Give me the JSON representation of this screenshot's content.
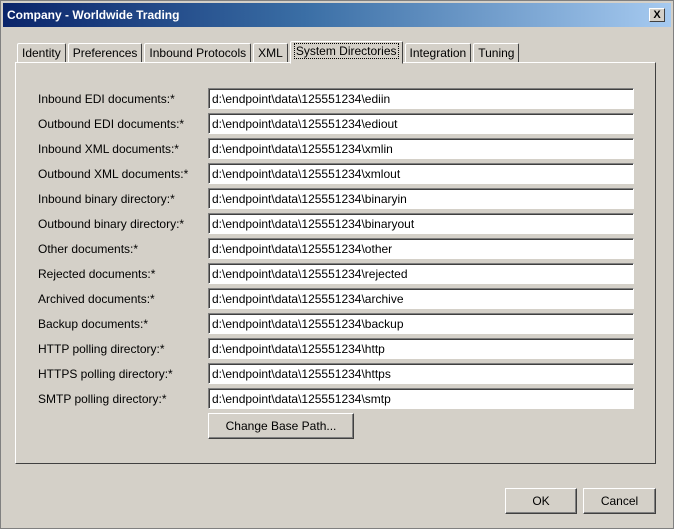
{
  "window": {
    "title": "Company - Worldwide Trading",
    "close_label": "X"
  },
  "tabs": [
    {
      "label": "Identity"
    },
    {
      "label": "Preferences"
    },
    {
      "label": "Inbound Protocols"
    },
    {
      "label": "XML"
    },
    {
      "label": "System Directories",
      "active": true
    },
    {
      "label": "Integration"
    },
    {
      "label": "Tuning"
    }
  ],
  "fields": [
    {
      "label": "Inbound EDI documents:*",
      "value": "d:\\endpoint\\data\\125551234\\ediin"
    },
    {
      "label": "Outbound EDI documents:*",
      "value": "d:\\endpoint\\data\\125551234\\ediout"
    },
    {
      "label": "Inbound XML documents:*",
      "value": "d:\\endpoint\\data\\125551234\\xmlin"
    },
    {
      "label": "Outbound XML documents:*",
      "value": "d:\\endpoint\\data\\125551234\\xmlout"
    },
    {
      "label": "Inbound binary directory:*",
      "value": "d:\\endpoint\\data\\125551234\\binaryin"
    },
    {
      "label": "Outbound binary directory:*",
      "value": "d:\\endpoint\\data\\125551234\\binaryout"
    },
    {
      "label": "Other documents:*",
      "value": "d:\\endpoint\\data\\125551234\\other"
    },
    {
      "label": "Rejected documents:*",
      "value": "d:\\endpoint\\data\\125551234\\rejected"
    },
    {
      "label": "Archived documents:*",
      "value": "d:\\endpoint\\data\\125551234\\archive"
    },
    {
      "label": "Backup documents:*",
      "value": "d:\\endpoint\\data\\125551234\\backup"
    },
    {
      "label": "HTTP polling directory:*",
      "value": "d:\\endpoint\\data\\125551234\\http"
    },
    {
      "label": "HTTPS polling directory:*",
      "value": "d:\\endpoint\\data\\125551234\\https"
    },
    {
      "label": "SMTP polling directory:*",
      "value": "d:\\endpoint\\data\\125551234\\smtp"
    }
  ],
  "buttons": {
    "change_base_path": "Change Base Path...",
    "ok": "OK",
    "cancel": "Cancel"
  }
}
